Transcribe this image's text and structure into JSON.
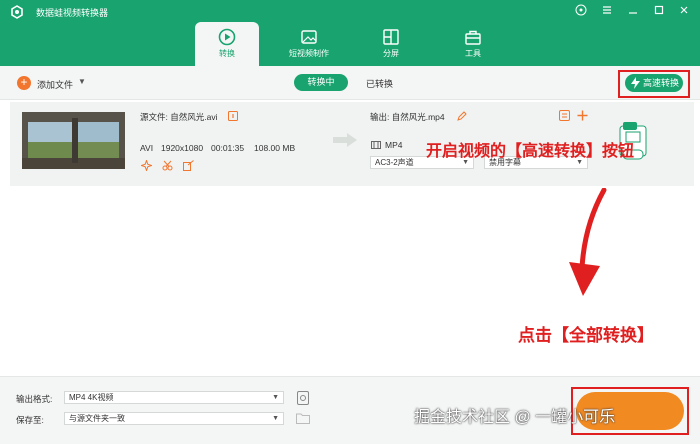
{
  "app": {
    "title": "数据蛙视频转换器"
  },
  "window": {
    "icons": [
      "help-icon",
      "menu-icon",
      "minimize-icon",
      "maximize-icon",
      "close-icon"
    ]
  },
  "tabs": [
    {
      "label": "转换",
      "icon": "convert-icon",
      "active": true
    },
    {
      "label": "短视频制作",
      "icon": "video-maker-icon",
      "active": false
    },
    {
      "label": "分屏",
      "icon": "split-screen-icon",
      "active": false
    },
    {
      "label": "工具",
      "icon": "toolbox-icon",
      "active": false
    }
  ],
  "toolbar": {
    "add_file_label": "添加文件",
    "segment_converting": "转换中",
    "segment_converted": "已转换",
    "speed_button_label": "高速转换"
  },
  "file": {
    "source_label": "源文件: 自然风光.avi",
    "format": "AVI",
    "resolution": "1920x1080",
    "duration": "00:01:35",
    "size": "108.00 MB",
    "output_label": "输出: 自然风光.mp4",
    "output_format": "MP4",
    "audio_select": "AC3-2声道",
    "subtitle_select": "禁用字幕"
  },
  "annotations": {
    "speed_hint": "开启视频的【高速转换】按钮",
    "convert_all_hint": "点击【全部转换】"
  },
  "bottom": {
    "output_format_label": "输出格式:",
    "output_format_value": "MP4 4K视频",
    "save_to_label": "保存至:",
    "save_to_value": "与源文件夹一致"
  },
  "watermark": "掘金技术社区 @ 一罐小可乐",
  "colors": {
    "brand": "#18a36f",
    "accent": "#f2762e",
    "annotation": "#e02020"
  }
}
